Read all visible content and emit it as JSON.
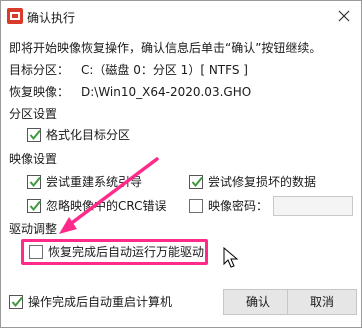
{
  "window": {
    "title": "确认执行",
    "close_icon": "close-icon"
  },
  "intro": "即将开始映像恢复操作，确认信息后单击“确认”按钮继续。",
  "target_partition": {
    "label": "目标分区：",
    "value": "C:（磁盘 0：分区 1）[ NTFS ]"
  },
  "restore_image": {
    "label": "恢复映像：",
    "value": "D:\\Win10_X64-2020.03.GHO"
  },
  "partition_settings": {
    "heading": "分区设置",
    "format_target": {
      "label": "格式化目标分区",
      "checked": true
    }
  },
  "image_settings": {
    "heading": "映像设置",
    "try_rebuild_boot": {
      "label": "尝试重建系统引导",
      "checked": true
    },
    "try_repair_data": {
      "label": "尝试修复损坏的数据",
      "checked": true
    },
    "ignore_crc": {
      "label": "忽略映像中的CRC错误",
      "checked": true
    },
    "image_password": {
      "label": "映像密码：",
      "checked": false,
      "value": ""
    }
  },
  "driver_settings": {
    "heading": "驱动调整",
    "auto_driver": {
      "label": "恢复完成后自动运行万能驱动",
      "checked": false
    }
  },
  "footer": {
    "auto_reboot": {
      "label": "操作完成后自动重启计算机",
      "checked": true
    },
    "confirm_label": "确认",
    "cancel_label": "取消"
  },
  "colors": {
    "highlight": "#ff2a8a",
    "check": "#3c9a3c",
    "app_icon": "#d83b2a"
  }
}
